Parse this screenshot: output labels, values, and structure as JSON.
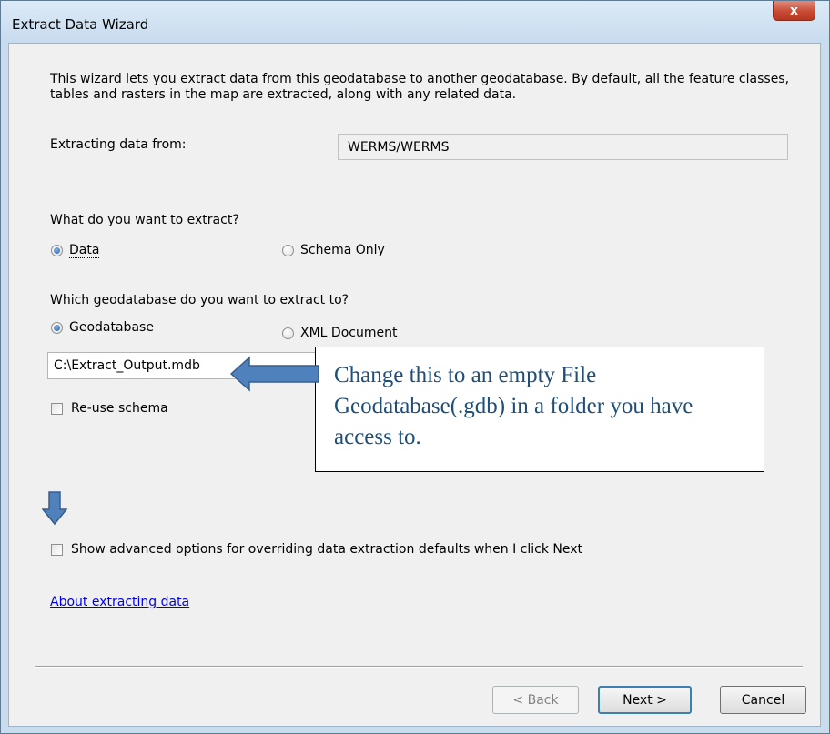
{
  "window": {
    "title": "Extract Data Wizard",
    "close_glyph": "x"
  },
  "intro_text": "This wizard lets you extract data from this geodatabase to another geodatabase. By default, all the feature classes, tables and rasters in the map are extracted, along with any related data.",
  "source": {
    "label": "Extracting data from:",
    "value": "WERMS/WERMS"
  },
  "extract_what": {
    "question": "What do you want to extract?",
    "options": [
      {
        "label": "Data",
        "selected": true
      },
      {
        "label": "Schema Only",
        "selected": false
      }
    ]
  },
  "target": {
    "question": "Which geodatabase do you want to extract to?",
    "options": [
      {
        "label": "Geodatabase",
        "selected": true
      },
      {
        "label": "XML Document",
        "selected": false
      }
    ],
    "path_value": "C:\\Extract_Output.mdb",
    "reuse_schema_label": "Re-use schema",
    "reuse_schema_checked": false
  },
  "callout_text": "Change this to an empty File Geodatabase(.gdb) in a folder you have access to.",
  "advanced": {
    "label": "Show advanced options for overriding data extraction defaults when I click Next",
    "checked": false
  },
  "about_link": "About extracting data",
  "buttons": {
    "back": "< Back",
    "next": "Next >",
    "cancel": "Cancel"
  },
  "colors": {
    "arrow": "#4f81bd",
    "arrow_border": "#385d8a",
    "link": "#0000ee",
    "callout_text": "#1f4e79"
  },
  "icons": {
    "browse": "folder-open-icon"
  }
}
